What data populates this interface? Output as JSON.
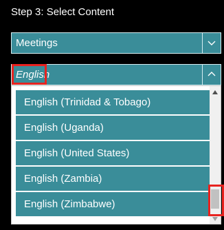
{
  "step": {
    "title": "Step 3: Select Content"
  },
  "meetings_select": {
    "value": "Meetings"
  },
  "language_select": {
    "value": "English"
  },
  "language_options": [
    "English (Trinidad & Tobago)",
    "English (Uganda)",
    "English (United States)",
    "English (Zambia)",
    "English (Zimbabwe)"
  ],
  "colors": {
    "accent": "#3a8d99",
    "highlight": "#e8231f",
    "background": "#000000"
  },
  "icons": {
    "meetings_arrow": "chevron-down-icon",
    "language_arrow": "chevron-up-icon",
    "scroll_up": "triangle-up-icon",
    "scroll_down": "triangle-down-icon"
  }
}
